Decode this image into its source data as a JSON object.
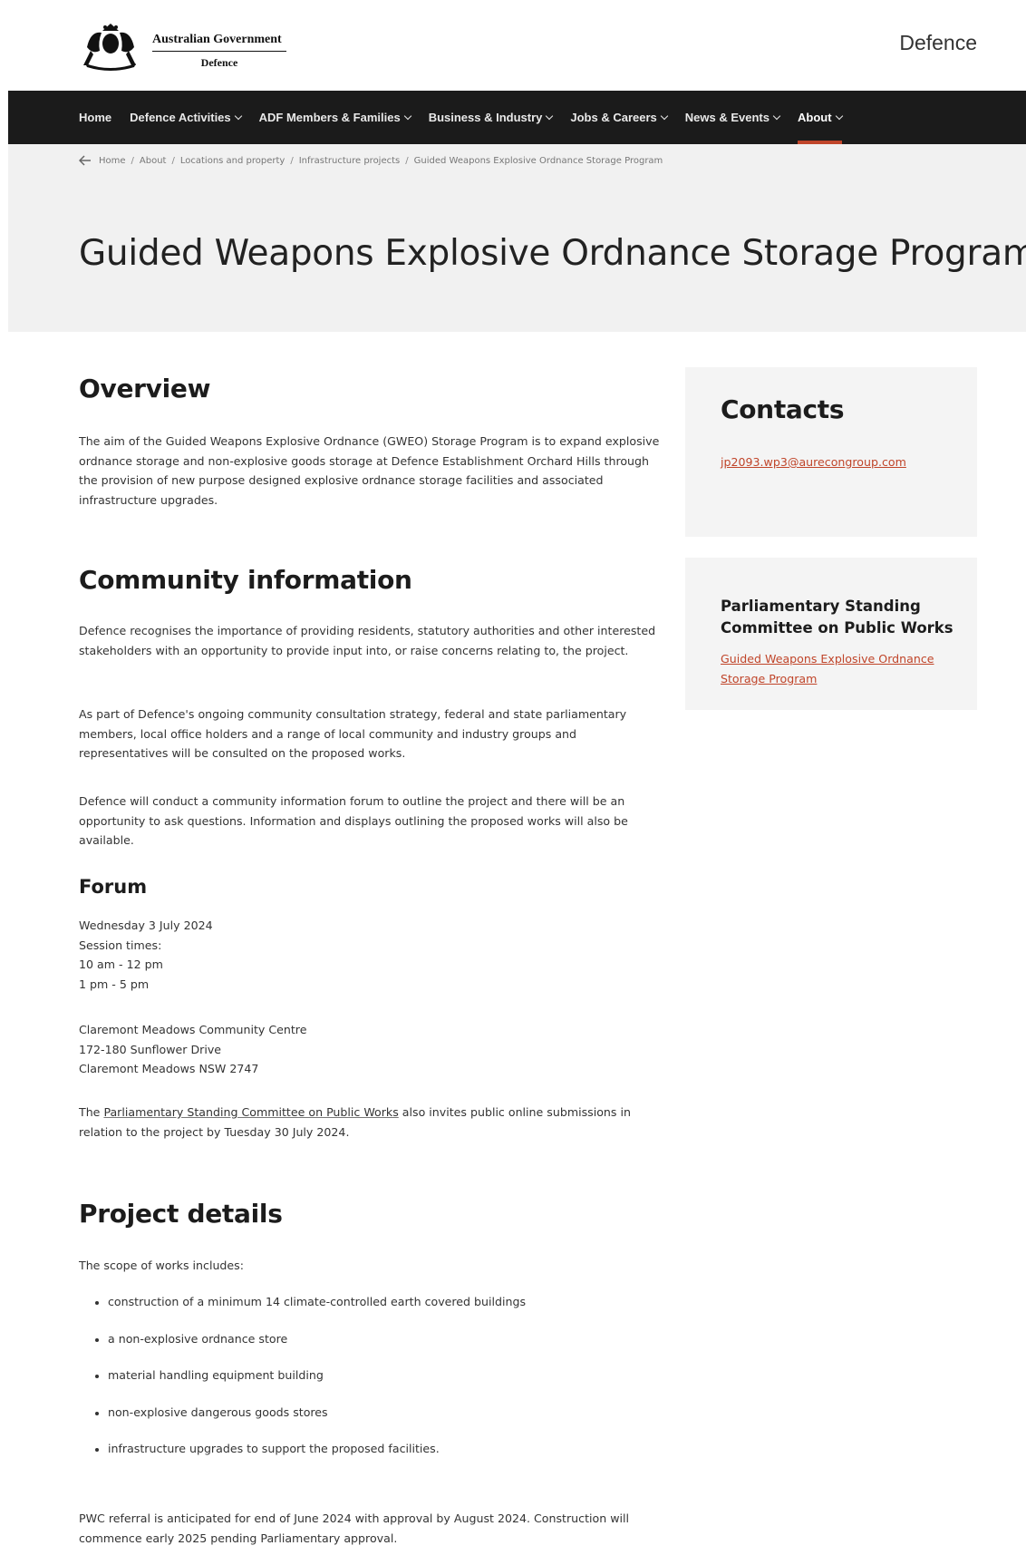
{
  "header": {
    "gov_title": "Australian Government",
    "gov_sub": "Defence",
    "site_name": "Defence"
  },
  "nav": {
    "items": [
      {
        "label": "Home",
        "dropdown": false
      },
      {
        "label": "Defence Activities",
        "dropdown": true
      },
      {
        "label": "ADF Members & Families",
        "dropdown": true
      },
      {
        "label": "Business & Industry",
        "dropdown": true
      },
      {
        "label": "Jobs & Careers",
        "dropdown": true
      },
      {
        "label": "News & Events",
        "dropdown": true
      },
      {
        "label": "About",
        "dropdown": true,
        "active": true
      }
    ],
    "accent_color": "#c0452a"
  },
  "breadcrumb": {
    "items": [
      "Home",
      "About",
      "Locations and property",
      "Infrastructure projects",
      "Guided Weapons Explosive Ordnance Storage Program"
    ]
  },
  "page": {
    "title": "Guided Weapons Explosive Ordnance Storage Program"
  },
  "overview": {
    "heading": "Overview",
    "text": "The aim of the Guided Weapons Explosive Ordnance (GWEO) Storage Program is to expand explosive ordnance storage and non-explosive goods storage at Defence Establishment Orchard Hills through the provision of new purpose designed explosive ordnance storage facilities and associated infrastructure upgrades."
  },
  "community": {
    "heading": "Community information",
    "p1": "Defence recognises the importance of providing residents, statutory authorities and other interested stakeholders with an opportunity to provide input into, or raise concerns relating to, the project.",
    "p2": "As part of Defence's ongoing community consultation strategy, federal and state parliamentary members, local office holders and a range of local community and industry groups and representatives will be consulted on the proposed works.",
    "p3": "Defence will conduct a community information forum to outline the project and there will be an opportunity to ask questions. Information and displays outlining the proposed works will also be available."
  },
  "forum": {
    "heading": "Forum",
    "date": "Wednesday 3 July 2024",
    "sessions_label": "Session times:",
    "session1": "10 am - 12 pm",
    "session2": "1 pm - 5 pm",
    "venue": "Claremont Meadows Community Centre",
    "street": "172-180 Sunflower Drive",
    "suburb": "Claremont Meadows NSW 2747",
    "pscpw_prefix": "The ",
    "pscpw_link": "Parliamentary Standing Committee on Public Works",
    "pscpw_suffix": " also invites public online submissions in relation to the project by Tuesday 30 July 2024."
  },
  "project": {
    "heading": "Project details",
    "scope_intro": "The scope of works includes:",
    "scope": [
      "construction of a minimum 14 climate-controlled earth covered buildings",
      "a non-explosive ordnance store",
      "material handling equipment building",
      "non-explosive dangerous goods stores",
      "infrastructure upgrades to support the proposed facilities."
    ],
    "pwc": "PWC referral is anticipated for end of June 2024 with approval by August 2024. Construction will commence early 2025 pending Parliamentary approval."
  },
  "sidebar": {
    "contacts_heading": "Contacts",
    "contacts_email": "jp2093.wp3@aurecongroup.com",
    "pscpw_heading": "Parliamentary Standing Committee on Public Works",
    "pscpw_link": "Guided Weapons Explosive Ordnance Storage Program"
  }
}
